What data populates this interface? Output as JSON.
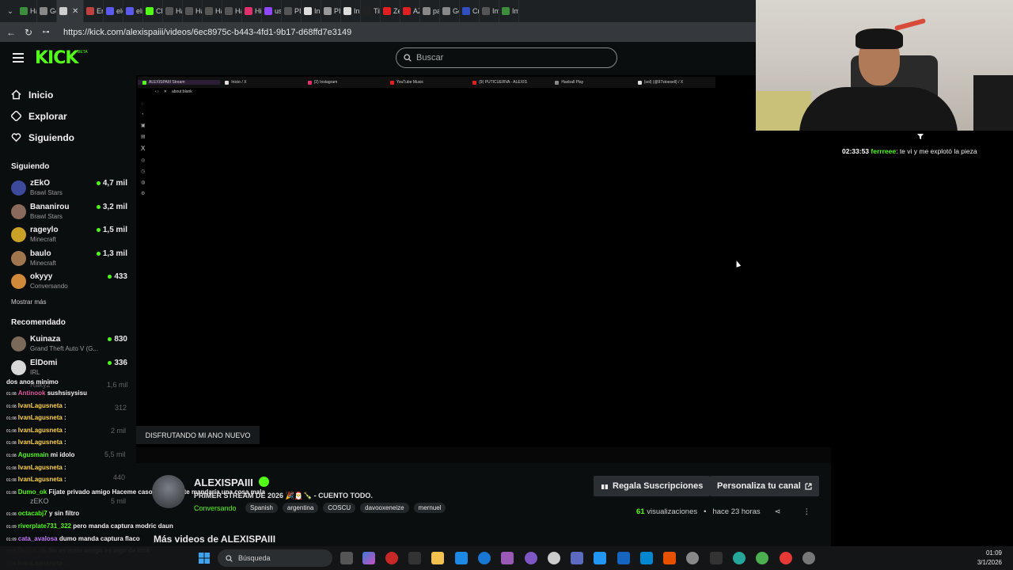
{
  "browser": {
    "tabs": [
      {
        "label": "Hax",
        "color": "#3c8d3c"
      },
      {
        "label": "Goo",
        "color": "#888"
      },
      {
        "label": "",
        "color": "#cfcfcf"
      },
      {
        "label": "Erro",
        "color": "#c04040"
      },
      {
        "label": "elch",
        "color": "#5a5af0"
      },
      {
        "label": "elru",
        "color": "#5a5af0"
      },
      {
        "label": "Cha",
        "color": "#53fc18"
      },
      {
        "label": "Hax",
        "color": "#555"
      },
      {
        "label": "Hax",
        "color": "#555"
      },
      {
        "label": "Hax",
        "color": "#555"
      },
      {
        "label": "Hax",
        "color": "#555"
      },
      {
        "label": "Hist",
        "color": "#e1306c"
      },
      {
        "label": "uste",
        "color": "#9146ff"
      },
      {
        "label": "PIX",
        "color": "#555"
      },
      {
        "label": "Inic",
        "color": "#ddd"
      },
      {
        "label": "PIX",
        "color": "#999"
      },
      {
        "label": "Inic",
        "color": "#ddd"
      },
      {
        "label": "Tik",
        "color": "#222"
      },
      {
        "label": "Zell",
        "color": "#e02020"
      },
      {
        "label": "AZZ",
        "color": "#e02020"
      },
      {
        "label": "pag",
        "color": "#888"
      },
      {
        "label": "Goo",
        "color": "#888"
      },
      {
        "label": "Crea",
        "color": "#3050c0"
      },
      {
        "label": "Img",
        "color": "#555"
      },
      {
        "label": "Img",
        "color": "#3c8d3c"
      }
    ],
    "active_tab_label": "",
    "url": "https://kick.com/alexispaiii/videos/6ec8975c-b443-4fd1-9b17-d68ffd7e3149"
  },
  "header": {
    "logo": "KICK",
    "logo_badge": "BETA",
    "search_placeholder": "Buscar"
  },
  "nav": {
    "inicio": "Inicio",
    "explorar": "Explorar",
    "siguiendo": "Siguiendo"
  },
  "following": {
    "title": "Siguiendo",
    "channels": [
      {
        "name": "zEkO",
        "category": "Brawl Stars",
        "viewers": "4,7 mil",
        "avatar_color": "#3b4a9a"
      },
      {
        "name": "Bananirou",
        "category": "Brawl Stars",
        "viewers": "3,2 mil",
        "avatar_color": "#8a6a5a"
      },
      {
        "name": "rageylo",
        "category": "Minecraft",
        "viewers": "1,5 mil",
        "avatar_color": "#c9a227"
      },
      {
        "name": "baulo",
        "category": "Minecraft",
        "viewers": "1,3 mil",
        "avatar_color": "#a0764f"
      },
      {
        "name": "okyyy",
        "category": "Conversando",
        "viewers": "433",
        "avatar_color": "#d28a3a"
      }
    ],
    "show_more": "Mostrar más"
  },
  "recommended": {
    "title": "Recomendado",
    "channels": [
      {
        "name": "Kuinaza",
        "category": "Grand Theft Auto V (G...",
        "viewers": "830",
        "avatar_color": "#7a6a5a"
      },
      {
        "name": "ElDomi",
        "category": "IRL",
        "viewers": "336",
        "avatar_color": "#d9d9d9"
      }
    ]
  },
  "overlay_chat": [
    {
      "time": "01:08",
      "user": "Antinook",
      "msg": "sushsisysisu",
      "color": "#e05aa0"
    },
    {
      "time": "01:08",
      "user": "IvanLagusneta",
      "msg": ":",
      "color": "#ffd54f"
    },
    {
      "time": "01:08",
      "user": "IvanLagusneta",
      "msg": ":",
      "color": "#ffd54f"
    },
    {
      "time": "01:08",
      "user": "IvanLagusneta",
      "msg": ":",
      "color": "#ffd54f"
    },
    {
      "time": "01:08",
      "user": "IvanLagusneta",
      "msg": ":",
      "color": "#ffd54f"
    },
    {
      "time": "01:08",
      "user": "Agusmain",
      "msg": "mi ídolo",
      "color": "#53fc18"
    },
    {
      "time": "01:08",
      "user": "IvanLagusneta",
      "msg": ":",
      "color": "#ffd54f"
    },
    {
      "time": "01:08",
      "user": "IvanLagusneta",
      "msg": ":",
      "color": "#ffd54f"
    },
    {
      "time": "01:08",
      "user": "Dumo_ok",
      "msg": "Fijate privado amigo Haceme caso confia no te mandaría una cosa mala",
      "color": "#53fc18"
    },
    {
      "time": "01:08",
      "user": "octacabj7",
      "msg": "y sin filtro",
      "color": "#53fc18"
    },
    {
      "time": "01:09",
      "user": "riverplate731_322",
      "msg": "pero manda captura modric daun",
      "color": "#53fc18"
    },
    {
      "time": "01:09",
      "user": "cata_avalosa",
      "msg": "dumo manda captura flaco",
      "color": "#c77dff"
    },
    {
      "time": "01:09",
      "user": "Dumo_ok",
      "msg": "No es malo amigo es algo de kick",
      "color": "#ff7043"
    },
    {
      "time": "01:09",
      "user": "IvanLagusneta",
      "msg": ":",
      "color": "#ffd54f"
    }
  ],
  "overlay_top_line": "dos anos minimo",
  "video": {
    "inner_tabs": [
      "ALEXISPAIII Stream",
      "Inicio / X",
      "(2) Instagram",
      "YouTube Music",
      "(9) PUTICUERVA - ALEXIS",
      "Haxball Play",
      "(sol) (@97stoesell) / X"
    ],
    "inner_url": "about:blank",
    "badge": "DISFRUTANDO MI ANO NUEVO"
  },
  "right_chat": {
    "time": "02:33:53",
    "user": "ferrreee",
    "msg": "te vi y me explotó la pieza"
  },
  "stream": {
    "channel": "ALEXISPAIII",
    "title": "PRIMER STREAM DE 2026 🎉🎅🍾 - CUENTO TODO.",
    "category": "Conversando",
    "tags": [
      "Spanish",
      "argentina",
      "COSCU",
      "davooxeneize",
      "mernuel"
    ],
    "btn_subs": "Regala Suscripciones",
    "btn_custom": "Personaliza tu canal",
    "views_num": "61",
    "views_label": "visualizaciones",
    "ago": "hace 23 horas",
    "more_videos": "Más videos de ALEXISPAIII"
  },
  "taskbar": {
    "search": "Búsqueda",
    "time": "01:09",
    "date": "3/1/2026"
  }
}
